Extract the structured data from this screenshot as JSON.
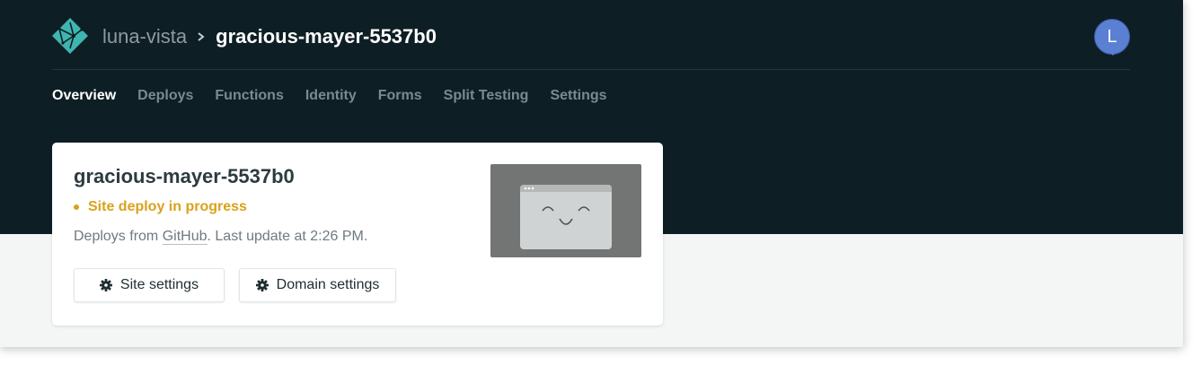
{
  "header": {
    "team_name": "luna-vista",
    "site_name": "gracious-mayer-5537b0",
    "avatar_initial": "L"
  },
  "nav": {
    "tabs": [
      {
        "label": "Overview",
        "active": true
      },
      {
        "label": "Deploys",
        "active": false
      },
      {
        "label": "Functions",
        "active": false
      },
      {
        "label": "Identity",
        "active": false
      },
      {
        "label": "Forms",
        "active": false
      },
      {
        "label": "Split Testing",
        "active": false
      },
      {
        "label": "Settings",
        "active": false
      }
    ]
  },
  "card": {
    "site_title": "gracious-mayer-5537b0",
    "status_text": "Site deploy in progress",
    "deploy_prefix": "Deploys from ",
    "deploy_source": "GitHub",
    "deploy_suffix": ". Last update at 2:26 PM.",
    "site_settings_label": "Site settings",
    "domain_settings_label": "Domain settings"
  },
  "icons": {
    "logo": "netlify-logo-icon",
    "breadcrumb_separator": "chevron-right-icon",
    "button_icon": "gear-icon",
    "thumbnail": "browser-smiley-icon"
  },
  "colors": {
    "header_bg": "#0e1e25",
    "page_bg": "#f4f6f6",
    "status": "#d9a21b",
    "avatar": "#5a7fd3",
    "logo": "#3fb5b0"
  }
}
